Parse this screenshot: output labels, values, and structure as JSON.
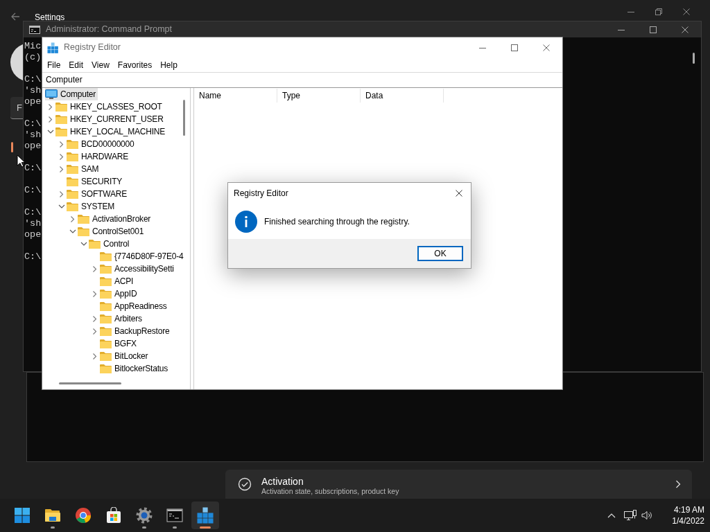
{
  "settings_window": {
    "title": "Settings",
    "search": {
      "value": "F"
    },
    "activation_card": {
      "title": "Activation",
      "subtitle": "Activation state, subscriptions, product key"
    }
  },
  "command_prompt": {
    "title": "Administrator: Command Prompt",
    "blocks": [
      [
        "Mic",
        "(c)"
      ],
      [
        "C:\\",
        "'sh",
        "ope"
      ],
      [
        "C:\\",
        "'sh",
        "ope"
      ],
      [
        "C:\\"
      ],
      [
        "C:\\"
      ],
      [
        "C:\\",
        "'sh",
        "ope"
      ],
      [
        "C:\\"
      ]
    ]
  },
  "registry_editor": {
    "title": "Registry Editor",
    "menu": [
      "File",
      "Edit",
      "View",
      "Favorites",
      "Help"
    ],
    "address": "Computer",
    "tree": [
      {
        "label": "Computer",
        "selected": true,
        "children": [
          {
            "label": "HKEY_CLASSES_ROOT",
            "selected": false,
            "expandable": true,
            "expanded": false
          },
          {
            "label": "HKEY_CURRENT_USER",
            "selected": false,
            "expandable": true,
            "expanded": false
          },
          {
            "label": "HKEY_LOCAL_MACHINE",
            "selected": false,
            "expandable": true,
            "expanded": true,
            "children": [
              {
                "label": "BCD00000000",
                "selected": false,
                "expandable": true,
                "expanded": false
              },
              {
                "label": "HARDWARE",
                "selected": false,
                "expandable": true,
                "expanded": false
              },
              {
                "label": "SAM",
                "selected": false,
                "expandable": true,
                "expanded": false
              },
              {
                "label": "SECURITY",
                "selected": false,
                "expandable": false
              },
              {
                "label": "SOFTWARE",
                "selected": false,
                "expandable": true,
                "expanded": false
              },
              {
                "label": "SYSTEM",
                "selected": false,
                "expandable": true,
                "expanded": true,
                "children": [
                  {
                    "label": "ActivationBroker",
                    "selected": false,
                    "expandable": true,
                    "expanded": false
                  },
                  {
                    "label": "ControlSet001",
                    "selected": false,
                    "expandable": true,
                    "expanded": true,
                    "children": [
                      {
                        "label": "Control",
                        "selected": false,
                        "expandable": true,
                        "expanded": true,
                        "children": [
                          {
                            "label": "{7746D80F-97E0-4",
                            "selected": false,
                            "expandable": false
                          },
                          {
                            "label": "AccessibilitySetti",
                            "selected": false,
                            "expandable": true,
                            "expanded": false
                          },
                          {
                            "label": "ACPI",
                            "selected": false,
                            "expandable": false
                          },
                          {
                            "label": "AppID",
                            "selected": false,
                            "expandable": true,
                            "expanded": false
                          },
                          {
                            "label": "AppReadiness",
                            "selected": false,
                            "expandable": false
                          },
                          {
                            "label": "Arbiters",
                            "selected": false,
                            "expandable": true,
                            "expanded": false
                          },
                          {
                            "label": "BackupRestore",
                            "selected": false,
                            "expandable": true,
                            "expanded": false
                          },
                          {
                            "label": "BGFX",
                            "selected": false,
                            "expandable": false
                          },
                          {
                            "label": "BitLocker",
                            "selected": false,
                            "expandable": true,
                            "expanded": false
                          },
                          {
                            "label": "BitlockerStatus",
                            "selected": false,
                            "expandable": false
                          }
                        ]
                      }
                    ]
                  }
                ]
              }
            ]
          }
        ]
      }
    ],
    "columns": [
      "Name",
      "Type",
      "Data"
    ]
  },
  "dialog": {
    "title": "Registry Editor",
    "message": "Finished searching through the registry.",
    "buttons": [
      {
        "label": "OK",
        "default": true
      }
    ]
  },
  "taskbar": {
    "apps": [
      {
        "kind": "start",
        "running": false,
        "selected": false
      },
      {
        "kind": "explorer",
        "running": true,
        "selected": false
      },
      {
        "kind": "browser",
        "running": false,
        "selected": false
      },
      {
        "kind": "store",
        "running": false,
        "selected": false
      },
      {
        "kind": "settings",
        "running": true,
        "selected": false
      },
      {
        "kind": "terminal",
        "running": true,
        "selected": false
      },
      {
        "kind": "registry",
        "running": true,
        "selected": true
      }
    ],
    "tray": {
      "time": "4:19 AM",
      "date": "1/4/2022"
    }
  }
}
